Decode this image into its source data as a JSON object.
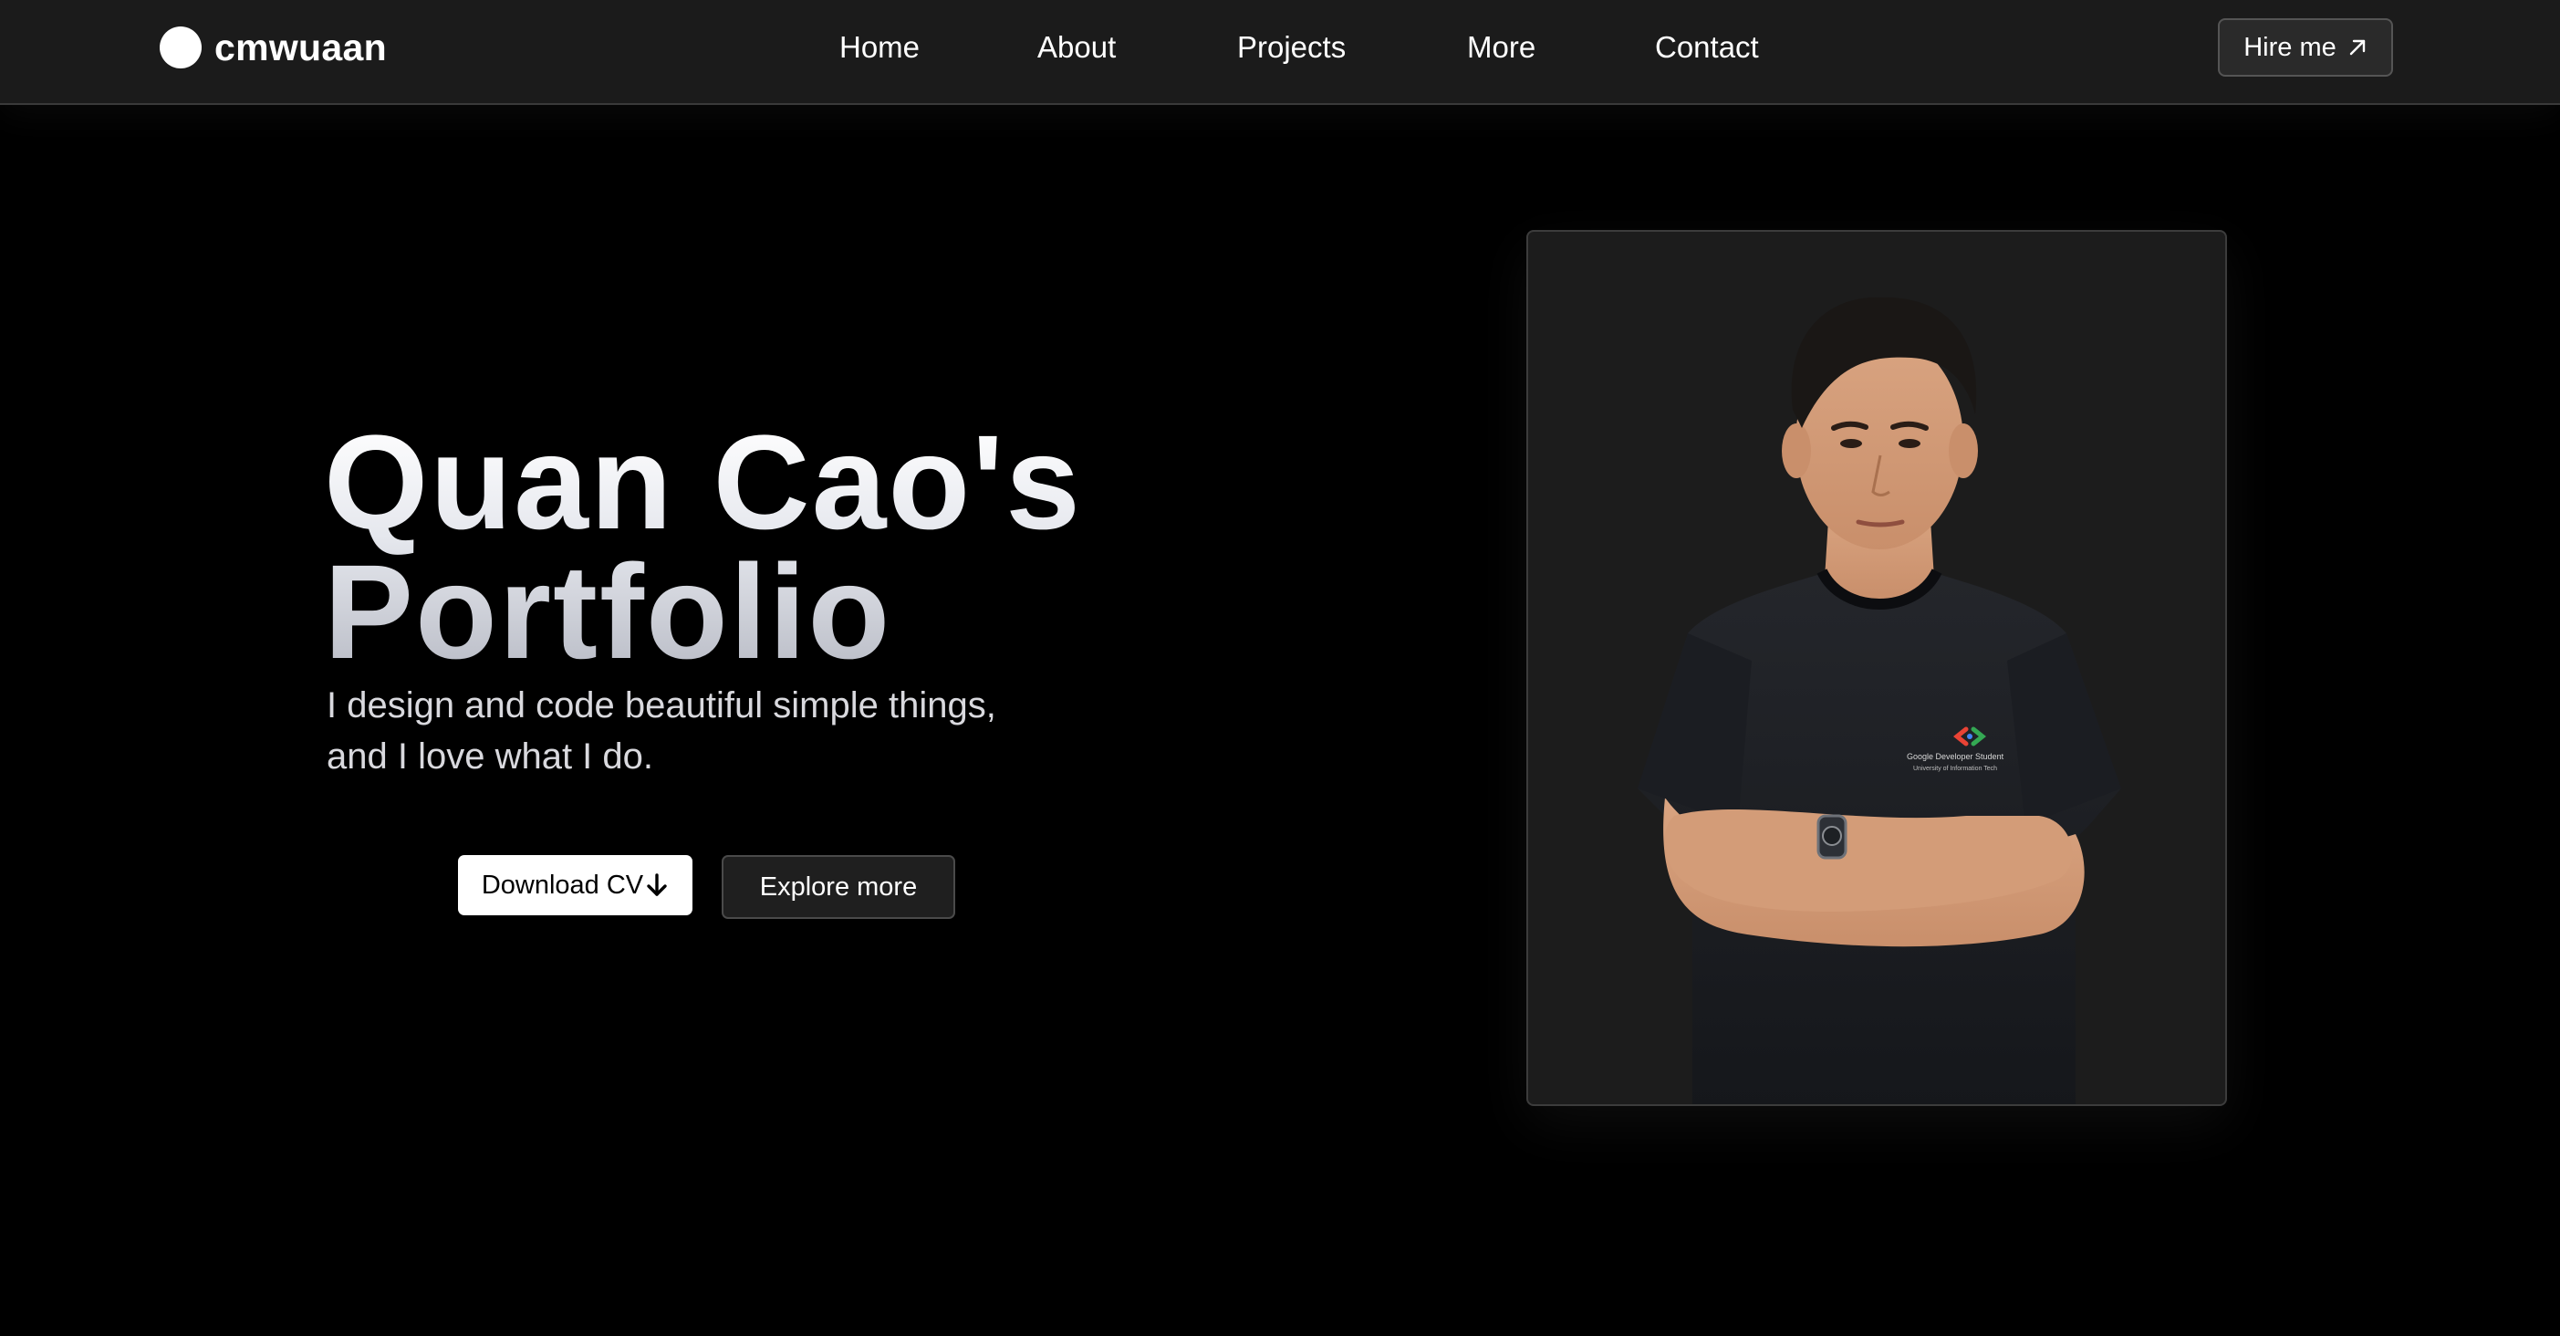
{
  "navbar": {
    "brand": "cmwuaan",
    "links": [
      {
        "label": "Home"
      },
      {
        "label": "About"
      },
      {
        "label": "Projects"
      },
      {
        "label": "More"
      },
      {
        "label": "Contact"
      }
    ],
    "hire_label": "Hire me",
    "hire_icon": "arrow-up-right-icon"
  },
  "hero": {
    "title_line1": "Quan Cao's",
    "title_line2": "Portfolio",
    "subtitle_line1": "I design and code beautiful simple things,",
    "subtitle_line2": "and I love what I do.",
    "download_label": "Download CV",
    "download_icon": "arrow-down-icon",
    "explore_label": "Explore more"
  },
  "portrait": {
    "shirt_text_line1": "Google Developer Student",
    "shirt_text_line2": "University of Information Tech"
  },
  "colors": {
    "page_bg": "#000000",
    "navbar_bg": "#1b1b1b",
    "card_bg": "#1c1c1c",
    "primary_button_bg": "#ffffff",
    "secondary_button_bg": "#1f1f1f"
  }
}
